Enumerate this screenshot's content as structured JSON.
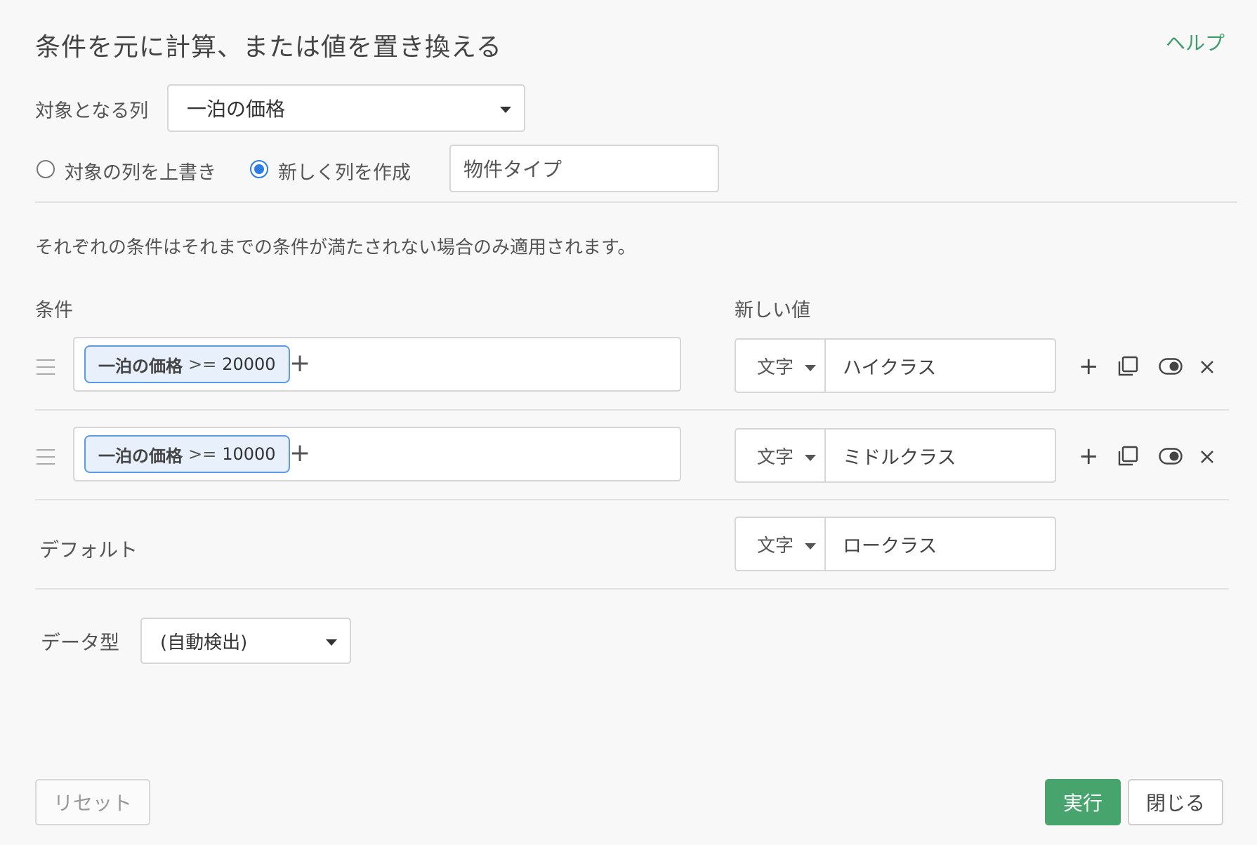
{
  "dialog": {
    "title": "条件を元に計算、または値を置き換える",
    "help": "ヘルプ"
  },
  "target": {
    "label": "対象となる列",
    "selected": "一泊の価格"
  },
  "mode": {
    "overwrite_label": "対象の列を上書き",
    "new_label": "新しく列を作成",
    "selected": "new",
    "new_column_name": "物件タイプ"
  },
  "note": "それぞれの条件はそれまでの条件が満たされない場合のみ適用されます。",
  "headers": {
    "condition": "条件",
    "new_value": "新しい値"
  },
  "conditions": [
    {
      "column": "一泊の価格",
      "operator": ">=",
      "value": "20000",
      "type": "文字",
      "new_value": "ハイクラス"
    },
    {
      "column": "一泊の価格",
      "operator": ">=",
      "value": "10000",
      "type": "文字",
      "new_value": "ミドルクラス"
    }
  ],
  "default": {
    "label": "デフォルト",
    "type": "文字",
    "value": "ロークラス"
  },
  "data_type": {
    "label": "データ型",
    "selected": "(自動検出)"
  },
  "buttons": {
    "reset": "リセット",
    "run": "実行",
    "close": "閉じる"
  },
  "colors": {
    "accent_green": "#46a46c",
    "radio_blue": "#2f7de1",
    "chip_border": "#5b9be6"
  }
}
